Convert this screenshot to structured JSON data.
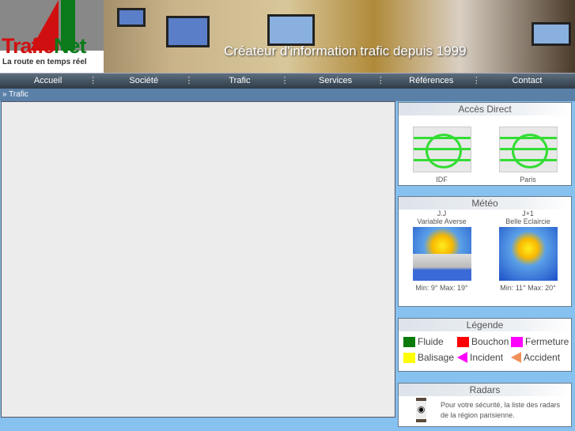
{
  "header": {
    "logo_name_a": "Trafic",
    "logo_name_b": "Net",
    "logo_tagline": "La route en temps réel",
    "slogan": "Créateur d'information trafic depuis 1999"
  },
  "nav": [
    "Accueil",
    "Société",
    "Trafic",
    "Services",
    "Références",
    "Contact"
  ],
  "breadcrumb": "Trafic",
  "acces_direct": {
    "title": "Accès Direct",
    "items": [
      "IDF",
      "Paris"
    ]
  },
  "meteo": {
    "title": "Météo",
    "days": [
      {
        "day": "J.J",
        "desc": "Variable Averse",
        "temps": "Min: 9° Max: 19°"
      },
      {
        "day": "J+1",
        "desc": "Belle Eclaircie",
        "temps": "Min: 11° Max: 20°"
      }
    ]
  },
  "legende": {
    "title": "Légende",
    "items": [
      {
        "label": "Fluide",
        "color": "#0a7a0a"
      },
      {
        "label": "Bouchon",
        "color": "#ff0000"
      },
      {
        "label": "Fermeture",
        "color": "#ff00ff"
      },
      {
        "label": "Balisage",
        "color": "#ffff00"
      },
      {
        "label": "Incident",
        "color": "#ff00ff"
      },
      {
        "label": "Accident",
        "color": "#f0905a"
      }
    ]
  },
  "radars": {
    "title": "Radars",
    "text": "Pour votre sécurité, la liste des radars de la région parisienne."
  }
}
